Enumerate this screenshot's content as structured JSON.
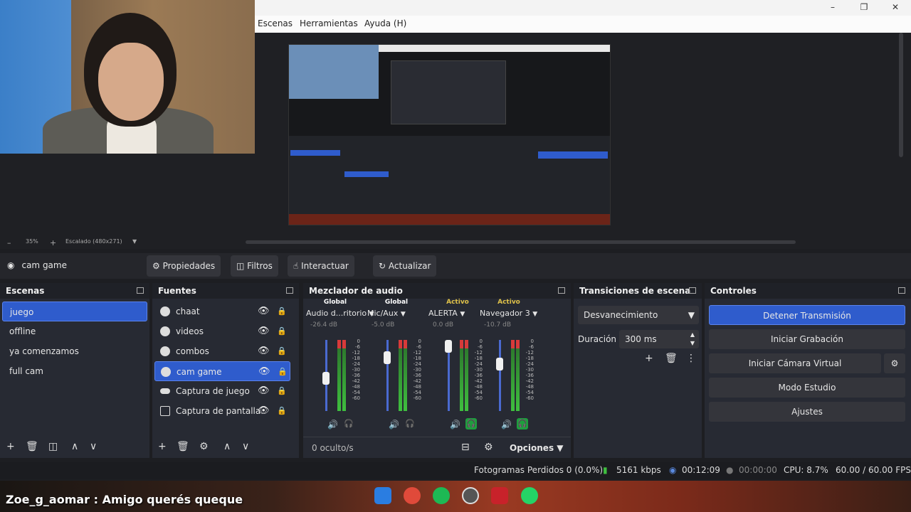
{
  "menubar": {
    "items": [
      "Escenas",
      "Herramientas",
      "Ayuda (H)"
    ]
  },
  "window_controls": {
    "minimize": "–",
    "maximize": "❐",
    "close": "✕"
  },
  "zoom": {
    "level": "35%",
    "scaling": "Escalado (480x271)"
  },
  "current_source": {
    "name": "cam game"
  },
  "source_toolbar": {
    "properties": "Propiedades",
    "filters": "Filtros",
    "interact": "Interactuar",
    "refresh": "Actualizar"
  },
  "scenes": {
    "title": "Escenas",
    "items": [
      "juego",
      "offline",
      "ya comenzamos",
      "full cam"
    ],
    "selected_index": 0
  },
  "sources": {
    "title": "Fuentes",
    "items": [
      "chaat",
      "videos",
      "combos",
      "cam game",
      "Captura de juego",
      "Captura de pantalla"
    ],
    "selected_index": 3
  },
  "mixer": {
    "title": "Mezclador de audio",
    "hidden_label": "0 oculto/s",
    "options_label": "Opciones",
    "channels": [
      {
        "top": "Global",
        "name": "Audio d...ritorio",
        "db": "-26.4 dB",
        "fader": 0.45,
        "monitor": false
      },
      {
        "top": "Global",
        "name": "Mic/Aux",
        "db": "-5.0 dB",
        "fader": 0.8,
        "monitor": false
      },
      {
        "top": "Activo",
        "name": "ALERTA",
        "db": "0.0 dB",
        "fader": 1.0,
        "monitor": true
      },
      {
        "top": "Activo",
        "name": "Navegador 3",
        "db": "-10.7 dB",
        "fader": 0.7,
        "monitor": true
      }
    ],
    "scale": [
      "0",
      "-6",
      "-12",
      "-18",
      "-24",
      "-30",
      "-36",
      "-42",
      "-48",
      "-54",
      "-60"
    ]
  },
  "transitions": {
    "title": "Transiciones de escena",
    "selected": "Desvanecimiento",
    "duration_label": "Duración",
    "duration_value": "300 ms"
  },
  "controls": {
    "title": "Controles",
    "stop_stream": "Detener Transmisión",
    "start_recording": "Iniciar Grabación",
    "start_virtual_cam": "Iniciar Cámara Virtual",
    "studio_mode": "Modo Estudio",
    "settings": "Ajustes"
  },
  "status": {
    "dropped_frames": "Fotogramas Perdidos 0 (0.0%)",
    "bitrate": "5161 kbps",
    "stream_time": "00:12:09",
    "rec_time": "00:00:00",
    "cpu": "CPU: 8.7%",
    "fps": "60.00 / 60.00 FPS"
  },
  "overlay": {
    "chat_line": "Zoe_g_aomar : Amigo querés queque"
  },
  "colors": {
    "accent": "#2f5ccc",
    "panel": "#272a33",
    "meter_green": "#3fbf3f",
    "meter_red": "#d83a3a",
    "active": "#e0c24a"
  }
}
